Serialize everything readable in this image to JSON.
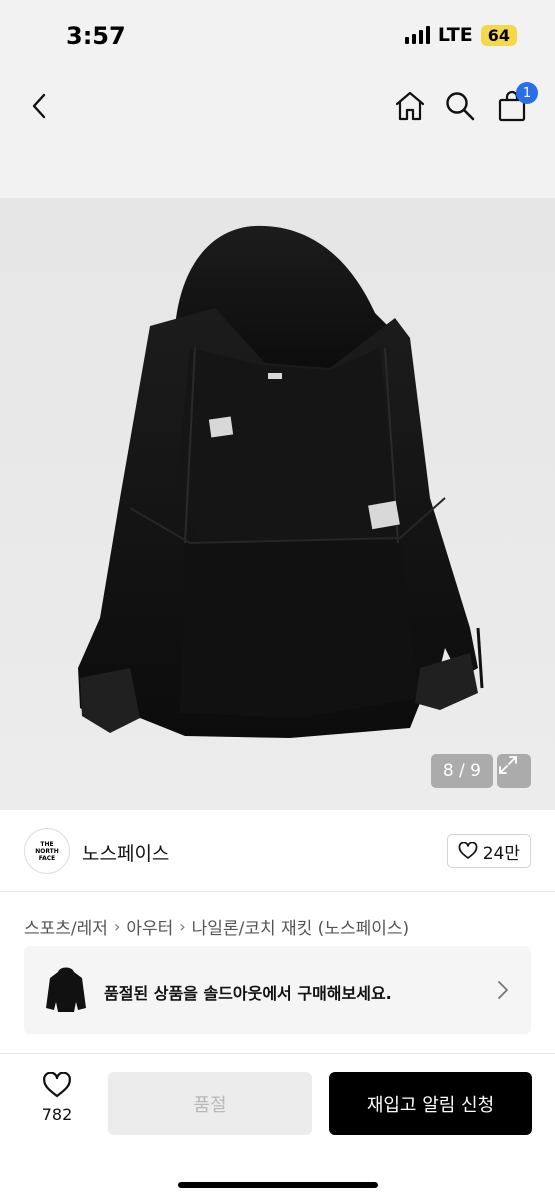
{
  "status_bar": {
    "time": "3:57",
    "network": "LTE",
    "battery": "64"
  },
  "nav": {
    "back_icon": "chevron-left-icon",
    "home_icon": "home-icon",
    "search_icon": "search-icon",
    "cart_icon": "shopping-bag-icon",
    "cart_badge": "1"
  },
  "image": {
    "counter": "8 / 9",
    "expand_icon": "expand-icon"
  },
  "brand": {
    "logo_lines": [
      "THE",
      "NORTH",
      "FACE"
    ],
    "name": "노스페이스",
    "likes": "24만"
  },
  "breadcrumb": [
    "스포츠/레저",
    "아우터",
    "나일론/코치 재킷 (노스페이스)"
  ],
  "soldout_banner": {
    "text": "품절된 상품을 솔드아웃에서 구매해보세요."
  },
  "bottom_bar": {
    "wish_count": "782",
    "soldout_label": "품절",
    "restock_label": "재입고 알림 신청"
  },
  "colors": {
    "badge": "#2a6ee8",
    "primary_button": "#000000",
    "disabled_button": "#ececec"
  }
}
